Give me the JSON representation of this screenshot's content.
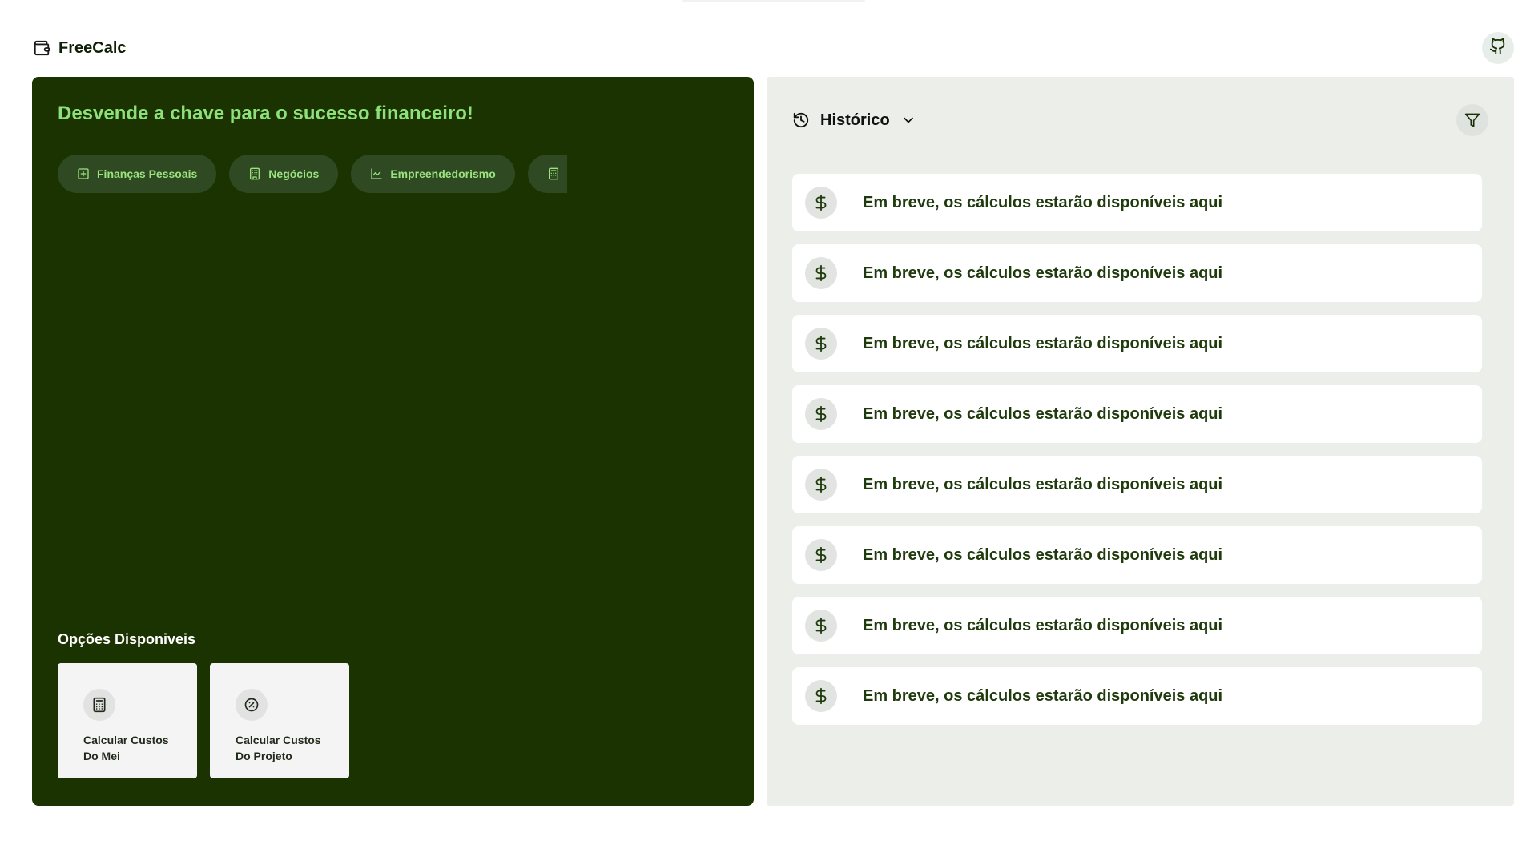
{
  "app": {
    "name": "FreeCalc"
  },
  "hero": {
    "headline": "Desvende a chave para o sucesso financeiro!",
    "categories": [
      {
        "label": "Finanças Pessoais",
        "icon": "ledger-icon"
      },
      {
        "label": "Negócios",
        "icon": "building-icon"
      },
      {
        "label": "Empreendedorismo",
        "icon": "line-chart-icon"
      },
      {
        "label": "",
        "icon": "calculator-icon"
      }
    ]
  },
  "options": {
    "title": "Opções Disponiveis",
    "cards": [
      {
        "label_line1": "Calcular Custos",
        "label_line2": "Do Mei",
        "icon": "calculator-icon"
      },
      {
        "label_line1": "Calcular Custos",
        "label_line2": "Do Projeto",
        "icon": "badge-percent-icon"
      }
    ]
  },
  "history": {
    "title": "Histórico",
    "items": [
      "Em breve, os cálculos estarão disponíveis aqui",
      "Em breve, os cálculos estarão disponíveis aqui",
      "Em breve, os cálculos estarão disponíveis aqui",
      "Em breve, os cálculos estarão disponíveis aqui",
      "Em breve, os cálculos estarão disponíveis aqui",
      "Em breve, os cálculos estarão disponíveis aqui",
      "Em breve, os cálculos estarão disponíveis aqui",
      "Em breve, os cálculos estarão disponíveis aqui"
    ]
  },
  "colors": {
    "panel_dark": "#1a3300",
    "accent_green": "#8ee07a",
    "chip_bg": "#2f4a22",
    "history_bg": "#eceeea"
  }
}
